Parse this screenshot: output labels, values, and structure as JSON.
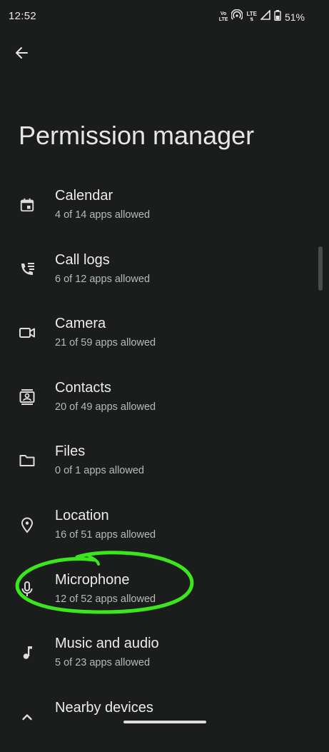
{
  "status_bar": {
    "time": "12:52",
    "volte_top": "Vo",
    "volte_bottom": "LTE",
    "lte": "LTE",
    "battery": "51%"
  },
  "page": {
    "title": "Permission manager"
  },
  "permissions": [
    {
      "label": "Calendar",
      "subtitle": "4 of 14 apps allowed",
      "icon": "calendar-icon"
    },
    {
      "label": "Call logs",
      "subtitle": "6 of 12 apps allowed",
      "icon": "call-log-icon"
    },
    {
      "label": "Camera",
      "subtitle": "21 of 59 apps allowed",
      "icon": "camera-icon"
    },
    {
      "label": "Contacts",
      "subtitle": "20 of 49 apps allowed",
      "icon": "contacts-icon"
    },
    {
      "label": "Files",
      "subtitle": "0 of 1 apps allowed",
      "icon": "folder-icon"
    },
    {
      "label": "Location",
      "subtitle": "16 of 51 apps allowed",
      "icon": "location-pin-icon"
    },
    {
      "label": "Microphone",
      "subtitle": "12 of 52 apps allowed",
      "icon": "microphone-icon"
    },
    {
      "label": "Music and audio",
      "subtitle": "5 of 23 apps allowed",
      "icon": "music-note-icon"
    },
    {
      "label": "Nearby devices",
      "subtitle": "",
      "icon": "nearby-devices-icon"
    }
  ],
  "colors": {
    "background": "#1b1d1c",
    "annotation": "#3be61d"
  }
}
